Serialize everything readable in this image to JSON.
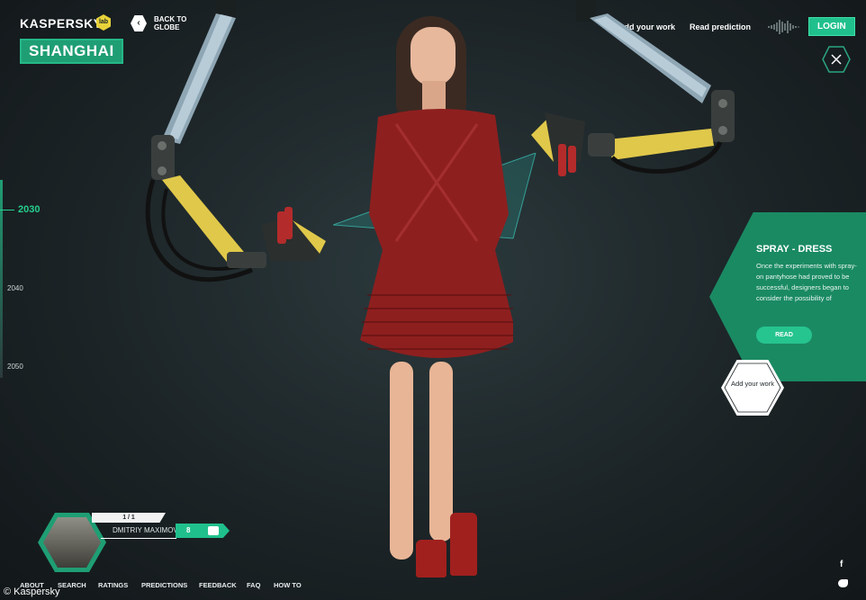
{
  "header": {
    "logo": "KASPERSKY",
    "logo_badge": "lab",
    "city": "SHANGHAI",
    "back_to_globe": "BACK TO GLOBE",
    "add_your_work": "Add your work",
    "read_prediction": "Read prediction",
    "login": "LOGIN"
  },
  "timeline": {
    "years": [
      "2030",
      "2040",
      "2050"
    ],
    "active": "2030"
  },
  "prediction": {
    "title": "SPRAY - DRESS",
    "text": "Once the experiments with spray-on pantyhose had proved to be successful, designers began to consider the possibility of",
    "read_label": "READ"
  },
  "add_work_hex": "Add your work",
  "author": {
    "counter": "1 / 1",
    "name": "DMITRIY MAXIMOV",
    "likes": "8"
  },
  "footer": {
    "links": [
      "ABOUT",
      "SEARCH",
      "RATINGS",
      "PREDICTIONS",
      "FEEDBACK",
      "FAQ",
      "HOW TO"
    ]
  },
  "social": {
    "facebook": "f"
  },
  "credit": "© Kaspersky",
  "colors": {
    "accent": "#20c08c",
    "card": "#1a8a63",
    "background": "#1c2427"
  }
}
